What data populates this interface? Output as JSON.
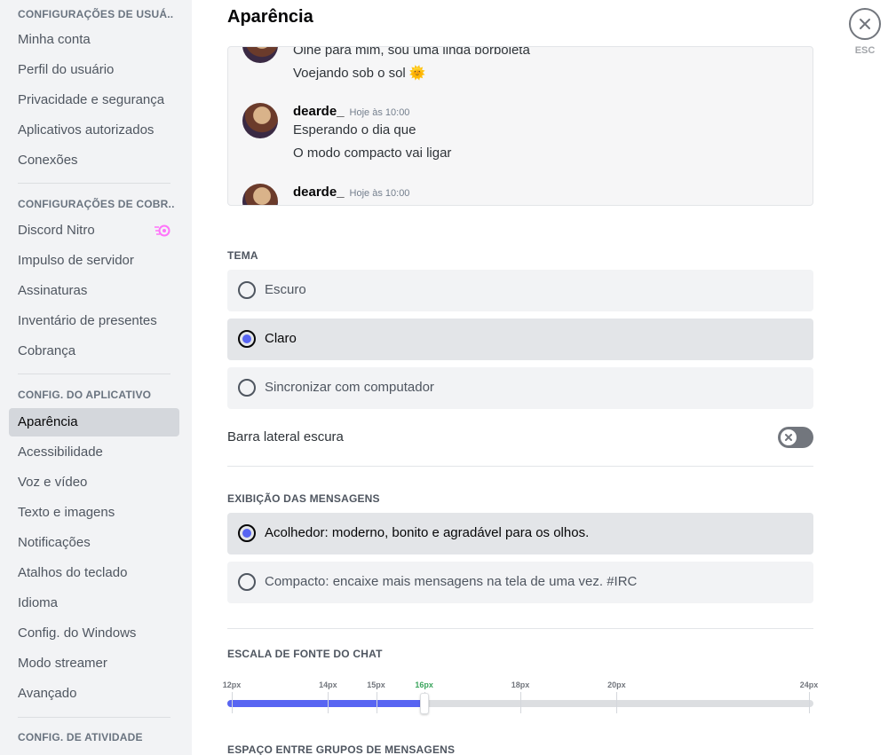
{
  "sidebar": {
    "sections": [
      {
        "header": "CONFIGURAÇÕES DE USUÁ...",
        "items": [
          "Minha conta",
          "Perfil do usuário",
          "Privacidade e segurança",
          "Aplicativos autorizados",
          "Conexões"
        ]
      },
      {
        "header": "CONFIGURAÇÕES DE COBR...",
        "items": [
          "Discord Nitro",
          "Impulso de servidor",
          "Assinaturas",
          "Inventário de presentes",
          "Cobrança"
        ]
      },
      {
        "header": "CONFIG. DO APLICATIVO",
        "items": [
          "Aparência",
          "Acessibilidade",
          "Voz e vídeo",
          "Texto e imagens",
          "Notificações",
          "Atalhos do teclado",
          "Idioma",
          "Config. do Windows",
          "Modo streamer",
          "Avançado"
        ]
      },
      {
        "header": "CONFIG. DE ATIVIDADE",
        "items": []
      }
    ],
    "selected_item": "Aparência",
    "nitro_icon": "nitro-icon"
  },
  "main": {
    "title": "Aparência",
    "close": {
      "icon": "close-icon",
      "label": "ESC"
    },
    "preview": {
      "messages": [
        {
          "lines": [
            "Olhe para mim, sou uma linda borboleta",
            "Voejando sob o sol 🌞"
          ]
        },
        {
          "author": "dearde_",
          "timestamp": "Hoje às 10:00",
          "lines": [
            "Esperando o dia que",
            "O modo compacto vai ligar"
          ]
        },
        {
          "author": "dearde_",
          "timestamp": "Hoje às 10:00",
          "lines": []
        }
      ]
    },
    "theme": {
      "label": "TEMA",
      "options": [
        "Escuro",
        "Claro",
        "Sincronizar com computador"
      ],
      "selected": "Claro"
    },
    "dark_sidebar": {
      "label": "Barra lateral escura",
      "enabled": false
    },
    "message_display": {
      "label": "EXIBIÇÃO DAS MENSAGENS",
      "options": [
        "Acolhedor: moderno, bonito e agradável para os olhos.",
        "Compacto: encaixe mais mensagens na tela de uma vez. #IRC"
      ],
      "selected": "Acolhedor: moderno, bonito e agradável para os olhos."
    },
    "font_scale": {
      "label": "ESCALA DE FONTE DO CHAT",
      "ticks": [
        "12px",
        "14px",
        "15px",
        "16px",
        "18px",
        "20px",
        "24px"
      ],
      "tick_values": [
        12,
        14,
        15,
        16,
        18,
        20,
        24
      ],
      "min": 12,
      "max": 24,
      "value": 16,
      "active_tick": "16px",
      "colors": {
        "fill": "#5865f2",
        "active_tick": "#3ba55d"
      }
    },
    "group_spacing": {
      "label": "ESPAÇO ENTRE GRUPOS DE MENSAGENS"
    }
  }
}
